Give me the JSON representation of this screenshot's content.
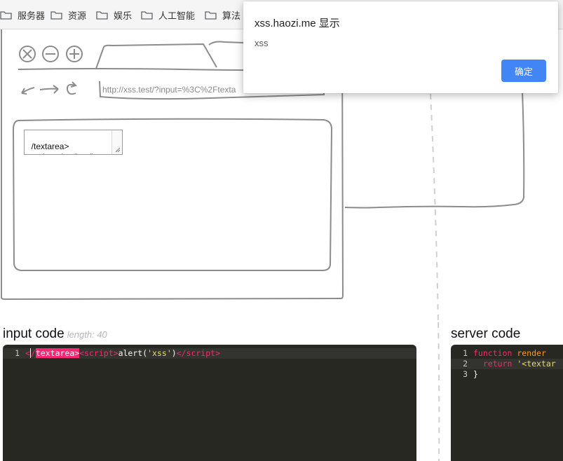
{
  "bookmarks": [
    {
      "label": "服务器",
      "icon": "folder-icon"
    },
    {
      "label": "资源",
      "icon": "folder-icon"
    },
    {
      "label": "娱乐",
      "icon": "folder-icon"
    },
    {
      "label": "人工智能",
      "icon": "folder-icon"
    },
    {
      "label": "算法",
      "icon": "folder-icon"
    }
  ],
  "sketch": {
    "url": "http://xss.test/?input=%3C%2Ftexta",
    "textarea_value": "/textarea>\n<script>alert('xss')"
  },
  "dialog": {
    "title": "xss.haozi.me 显示",
    "message": "xss",
    "ok_label": "确定"
  },
  "input_panel": {
    "title": "input code",
    "length_label": "length: 40",
    "line_number": "1"
  },
  "server_panel": {
    "title": "server code",
    "line_numbers": [
      "1",
      "2",
      "3"
    ]
  },
  "colors": {
    "editor_bg": "#272822",
    "tag": "#f92672",
    "string": "#e6db74",
    "function_name": "#fd971f",
    "dialog_button": "#4285f4"
  }
}
